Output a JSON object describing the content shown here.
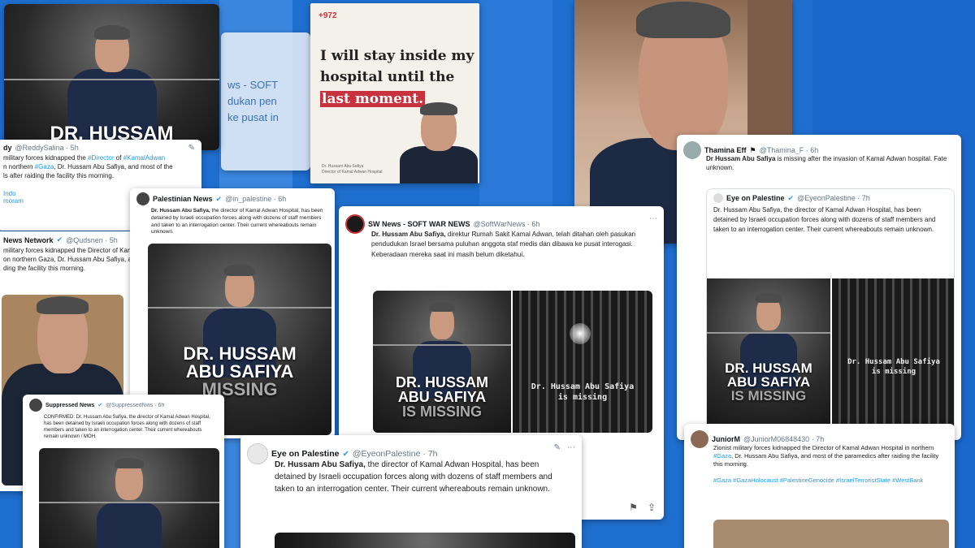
{
  "cards": {
    "topleft": {
      "headline": "DR. HUSSAM"
    },
    "poster": {
      "phone": "+972",
      "line1": "I will stay inside my",
      "line2": "hospital until the",
      "line3": "last moment.",
      "caption1": "Dr. Hussam Abu Safiya",
      "caption2": "Director of Kamal Adwan Hospital"
    },
    "bg_tweet": {
      "line1": "ws - SOFT",
      "line2": "dukan pen",
      "line3": "ke pusat in"
    },
    "tw_reddy": {
      "name": "dy",
      "handle": "@ReddySalina · 5h",
      "body1": "military forces kidnapped the",
      "body_link1": "#Director",
      "body2": "of",
      "body_link2": "#KamalAdwan",
      "body3": "n northern",
      "body_link3": "#Gaza",
      "body4": ", Dr. Hussam Abu Safiya, and most of the",
      "body5": "ls after raiding the facility this morning.",
      "footer1": "Indo",
      "footer2": "moram"
    },
    "tw_news_network": {
      "name": "News Network",
      "handle": "@Qudsnen · 5h",
      "body1": "military forces kidnapped the Director of Kam",
      "body2": "on northern Gaza, Dr. Hussam Abu Safiya, and",
      "body3": "ding the facility this morning."
    },
    "tw_palestinian_news": {
      "name": "Palestinian News",
      "handle": "@in_palestine · 6h",
      "body_bold": "Dr. Hussam Abu Safiya,",
      "body": "the director of Kamal Adwan Hospital, has been detained by Israeli occupation forces along with dozens of staff members and taken to an interrogation center. Their current whereabouts remain unknown.",
      "img_line1": "DR. HUSSAM",
      "img_line2": "ABU SAFIYA",
      "img_line3": "MISSING"
    },
    "tw_suppressed": {
      "name": "Suppressed News",
      "handle": "@SuppressedNws · 6h",
      "body": "CONFIRMED: Dr. Hussam Abu Safiya, the director of Kamal Adwan Hospital, has been detained by Israeli occupation forces along with dozens of staff members and taken to an interrogation center. Their current whereabouts remain unknown / MOH."
    },
    "tw_softwarnews": {
      "name": "SW News - SOFT WAR NEWS",
      "handle": "@SoftWarNews · 6h",
      "body_bold": "Dr. Hussam Abu Safiya,",
      "body": "direktur Rumah Sakit Kamal Adwan, telah ditahan oleh pasukan pendudukan Israel bersama puluhan anggota staf medis dan dibawa ke pusat interogasi. Keberadaan mereka saat ini masih belum diketahui.",
      "img1_line1": "DR. HUSSAM",
      "img1_line2": "ABU SAFIYA",
      "img1_line3": "IS MISSING",
      "img2_line1": "Dr. Hussam Abu Safiya",
      "img2_line2": "is missing"
    },
    "tw_eye_main": {
      "name": "Eye on Palestine",
      "handle": "@EyeonPalestine · 7h",
      "body_bold": "Dr. Hussam Abu Safiya,",
      "body": "the director of Kamal Adwan Hospital, has been detained by Israeli occupation forces along with dozens of staff members and taken to an interrogation center. Their current whereabouts remain unknown."
    },
    "tw_thamina": {
      "name": "Thamina Eff",
      "handle": "@Thamina_F · 6h",
      "body_bold": "Dr Hussam Abu Safiya",
      "body": "is missing after the invasion of Kamal Adwan hospital. Fate unknown.",
      "quote_name": "Eye on Palestine",
      "quote_handle": "@EyeonPalestine · 7h",
      "quote_body": "Dr. Hussam Abu Safiya, the director of Kamal Adwan Hospital, has been detained by Israeli occupation forces along with dozens of staff members and taken to an interrogation center. Their current whereabouts remain unknown.",
      "img1_line1": "DR. HUSSAM",
      "img1_line2": "ABU SAFIYA",
      "img1_line3": "IS MISSING",
      "img2_line1": "Dr. Hussam Abu Safiya",
      "img2_line2": "is missing"
    },
    "tw_junior": {
      "name": "JuniorM",
      "handle": "@JuniorM06848430 · 7h",
      "body1": "Zionist military forces kidnapped the Director of Kamal Adwan Hospital in northern",
      "body_link1": "#Gaza",
      "body2": ", Dr. Hussam Abu Safiya, and most of the paramedics after raiding the facility this morning.",
      "tags": "#Gaza #GazaHolocaust #PalestineGenocide #IsraelTerroristState #WestBank"
    }
  },
  "colors": {
    "background": "#1f6fd0",
    "link": "#1d9bf0",
    "poster_highlight": "#c8323c"
  },
  "icons": [
    "more-icon",
    "verified-badge-icon",
    "grok-icon",
    "bookmark-icon",
    "share-icon",
    "flag-icon"
  ]
}
